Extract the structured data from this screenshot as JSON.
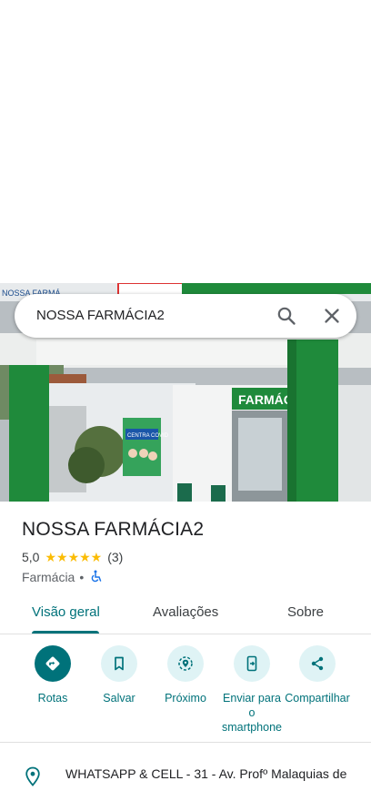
{
  "search": {
    "query": "NOSSA FARMÁCIA2"
  },
  "photo": {
    "storefront_sign": "FARMÁC",
    "poster_text": "CENTRA COVID",
    "top_sign": "NOSSA FARMÁ"
  },
  "place": {
    "name": "NOSSA FARMÁCIA2",
    "rating": "5,0",
    "stars": "★★★★★",
    "review_count": "(3)",
    "category": "Farmácia",
    "separator": "•"
  },
  "tabs": [
    {
      "label": "Visão geral",
      "active": true
    },
    {
      "label": "Avaliações",
      "active": false
    },
    {
      "label": "Sobre",
      "active": false
    }
  ],
  "actions": [
    {
      "label": "Rotas",
      "icon": "directions-icon"
    },
    {
      "label": "Salvar",
      "icon": "bookmark-icon"
    },
    {
      "label": "Próximo",
      "icon": "nearby-icon"
    },
    {
      "label": "Enviar para o smartphone",
      "icon": "send-to-phone-icon"
    },
    {
      "label": "Compartilhar",
      "icon": "share-icon"
    }
  ],
  "address": {
    "text": "WHATSAPP & CELL - 31 - Av. Profº Malaquias de"
  },
  "colors": {
    "accent": "#00727a",
    "accent_light": "#dff3f5",
    "star": "#fbbc04",
    "pillar": "#1f8a3b"
  }
}
